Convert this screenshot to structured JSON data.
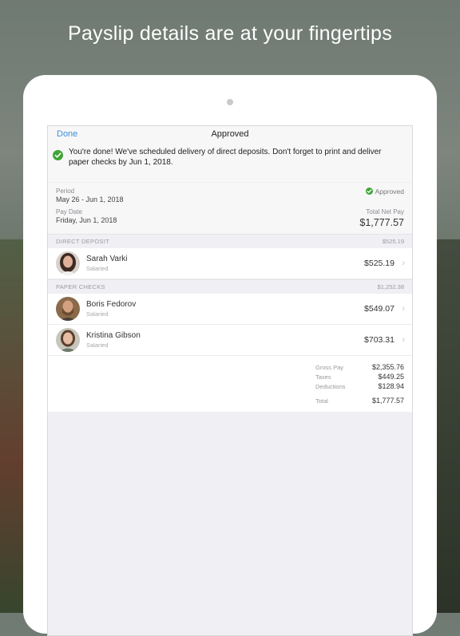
{
  "headline": "Payslip details are at your fingertips",
  "nav": {
    "done_label": "Done",
    "title": "Approved"
  },
  "banner": {
    "message": "You're done! We've scheduled delivery of direct deposits. Don't forget to print and deliver paper checks by Jun 1, 2018."
  },
  "summary": {
    "period_label": "Period",
    "period_value": "May 26 - Jun 1, 2018",
    "status": "Approved",
    "pay_date_label": "Pay Date",
    "pay_date_value": "Friday, Jun 1, 2018",
    "net_pay_label": "Total Net Pay",
    "net_pay_value": "$1,777.57"
  },
  "direct_deposit": {
    "header": "DIRECT DEPOSIT",
    "total": "$525.19",
    "employees": [
      {
        "name": "Sarah Varki",
        "type": "Salaried",
        "amount": "$525.19"
      }
    ]
  },
  "paper_checks": {
    "header": "PAPER CHECKS",
    "total": "$1,252.38",
    "employees": [
      {
        "name": "Boris Fedorov",
        "type": "Salaried",
        "amount": "$549.07"
      },
      {
        "name": "Kristina Gibson",
        "type": "Salaried",
        "amount": "$703.31"
      }
    ]
  },
  "totals": {
    "gross_label": "Gross Pay",
    "gross_value": "$2,355.76",
    "taxes_label": "Taxes",
    "taxes_value": "$449.25",
    "deductions_label": "Deductions",
    "deductions_value": "$128.94",
    "total_label": "Total",
    "total_value": "$1,777.57"
  },
  "colors": {
    "accent": "#3a8fd9",
    "success": "#3fa535"
  },
  "icons": {
    "check": "check-circle-icon",
    "chevron": "chevron-right-icon"
  }
}
